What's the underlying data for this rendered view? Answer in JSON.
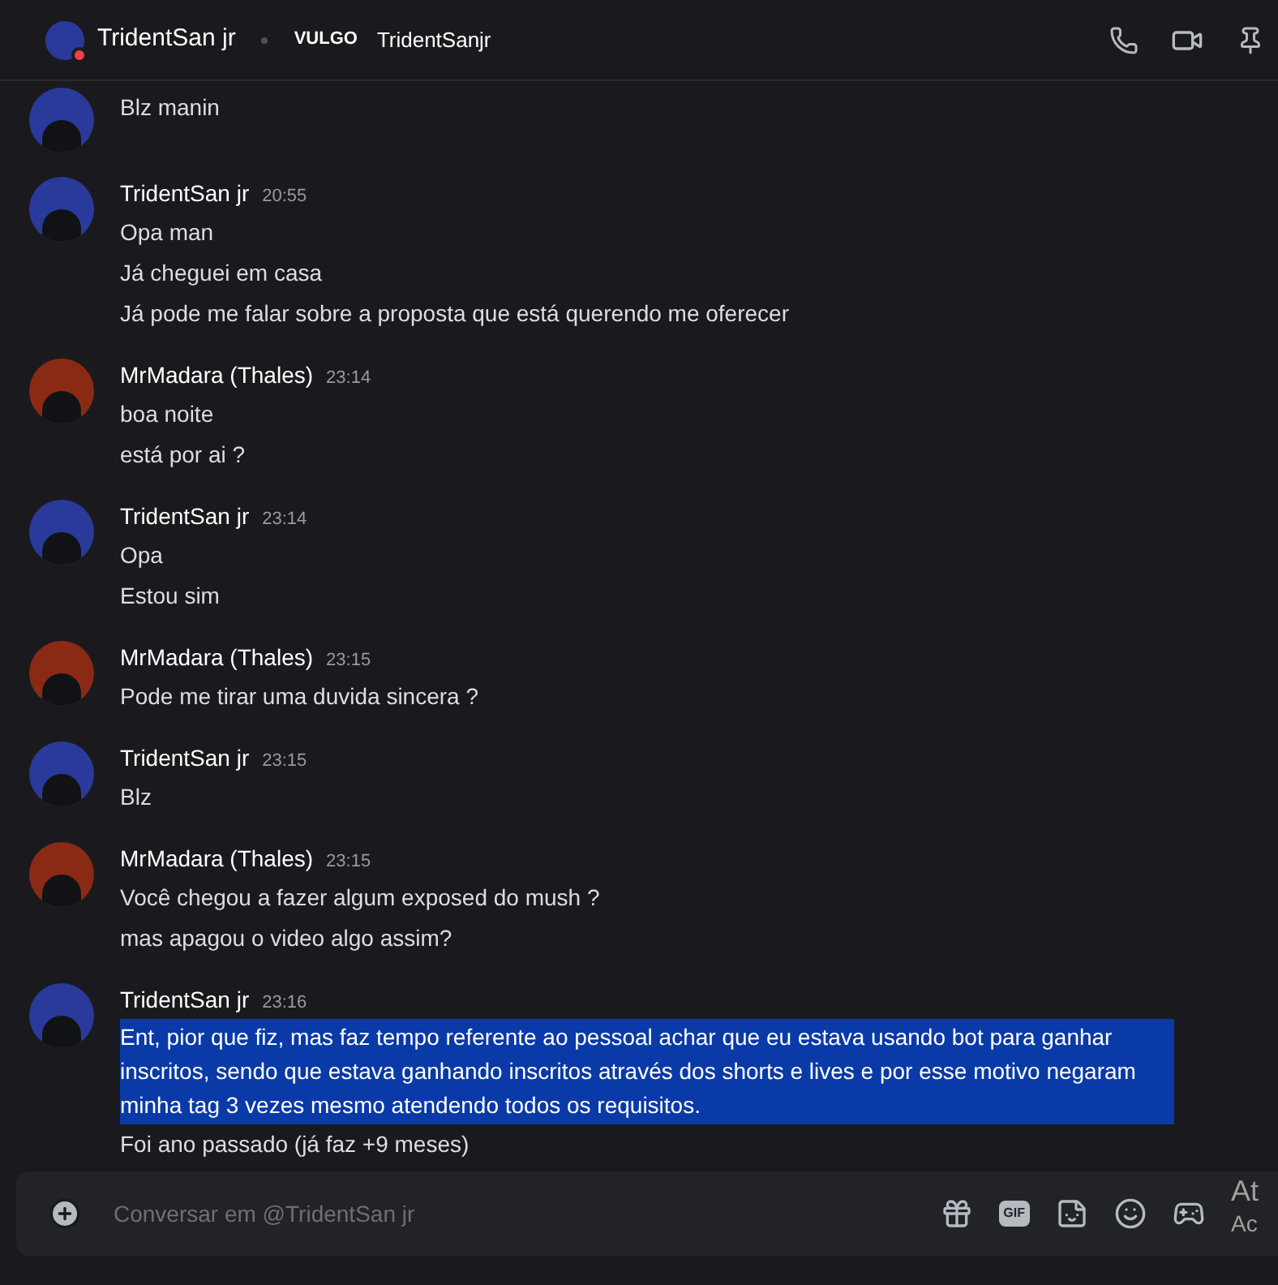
{
  "header": {
    "name": "TridentSan jr",
    "do_not_disturb": true,
    "tag": "VULGO",
    "username": "TridentSanjr"
  },
  "messages": [
    {
      "kind": "continuation",
      "color": "#2a3a9a",
      "lines": [
        {
          "text": "Blz manin",
          "highlighted": false
        }
      ]
    },
    {
      "kind": "group",
      "author": "TridentSan jr",
      "time": "20:55",
      "color": "#2a3a9a",
      "lines": [
        {
          "text": "Opa man",
          "highlighted": false
        },
        {
          "text": "Já cheguei em casa",
          "highlighted": false
        },
        {
          "text": "Já pode me falar sobre a proposta que está querendo me oferecer",
          "highlighted": false
        }
      ]
    },
    {
      "kind": "group",
      "author": "MrMadara (Thales)",
      "time": "23:14",
      "color": "#8a2a14",
      "lines": [
        {
          "text": "boa noite",
          "highlighted": false
        },
        {
          "text": "está por ai ?",
          "highlighted": false
        }
      ]
    },
    {
      "kind": "group",
      "author": "TridentSan jr",
      "time": "23:14",
      "color": "#2a3a9a",
      "lines": [
        {
          "text": "Opa",
          "highlighted": false
        },
        {
          "text": "Estou sim",
          "highlighted": false
        }
      ]
    },
    {
      "kind": "group",
      "author": "MrMadara (Thales)",
      "time": "23:15",
      "color": "#8a2a14",
      "lines": [
        {
          "text": "Pode me tirar uma duvida sincera ?",
          "highlighted": false
        }
      ]
    },
    {
      "kind": "group",
      "author": "TridentSan jr",
      "time": "23:15",
      "color": "#2a3a9a",
      "lines": [
        {
          "text": "Blz",
          "highlighted": false
        }
      ]
    },
    {
      "kind": "group",
      "author": "MrMadara (Thales)",
      "time": "23:15",
      "color": "#8a2a14",
      "lines": [
        {
          "text": "Você chegou a fazer algum exposed do mush ?",
          "highlighted": false
        },
        {
          "text": "mas apagou o video algo assim?",
          "highlighted": false
        }
      ]
    },
    {
      "kind": "group",
      "author": "TridentSan jr",
      "time": "23:16",
      "color": "#2a3a9a",
      "lines": [
        {
          "text": "Ent, pior que fiz, mas faz tempo referente ao pessoal achar que eu estava usando bot para ganhar inscritos, sendo que estava ganhando inscritos através dos shorts e lives e por esse motivo negaram minha tag 3 vezes mesmo atendendo todos os requisitos.",
          "highlighted": true
        },
        {
          "text": "Foi ano passado (já faz +9 meses)",
          "highlighted": false
        }
      ]
    }
  ],
  "composer": {
    "placeholder": "Conversar em @TridentSan jr",
    "gif_label": "GIF"
  },
  "overlay_lines": [
    "At",
    "Ac"
  ]
}
